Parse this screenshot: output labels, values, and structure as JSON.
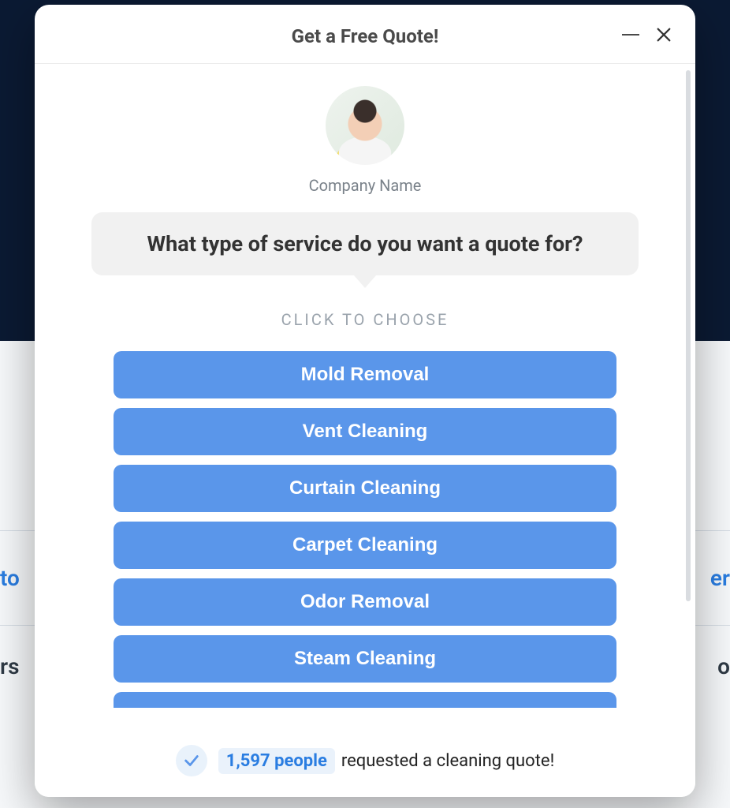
{
  "background": {
    "link_left": "to",
    "link_right": "er",
    "text_left": "rs",
    "text_right": "o"
  },
  "modal": {
    "title": "Get a Free Quote!",
    "company_label": "Company Name",
    "question": "What type of service do you want a quote for?",
    "choose_label": "CLICK TO CHOOSE",
    "options": [
      "Mold Removal",
      "Vent Cleaning",
      "Curtain Cleaning",
      "Carpet Cleaning",
      "Odor Removal",
      "Steam Cleaning"
    ],
    "footer": {
      "count_text": "1,597 people",
      "rest_text": "requested a cleaning quote!"
    }
  }
}
